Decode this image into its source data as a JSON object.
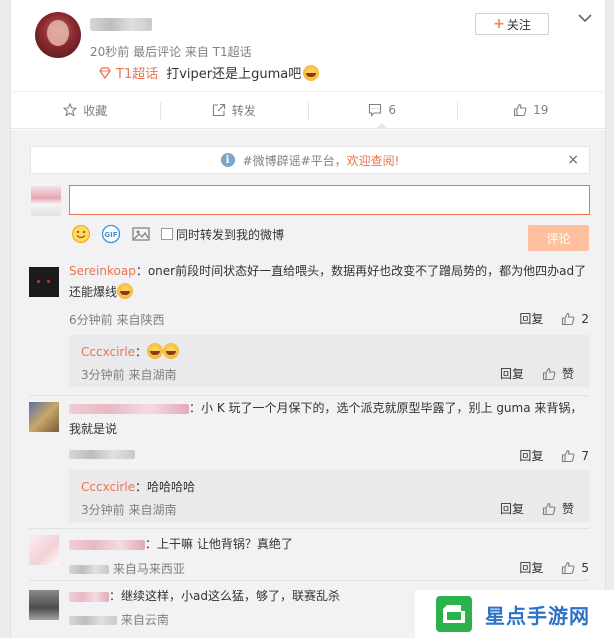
{
  "post": {
    "meta": "20秒前 最后评论 来自 T1超话",
    "topic": "T1超话",
    "body": "打viper还是上guma吧",
    "follow_label": "关注"
  },
  "actions": [
    {
      "label": "收藏",
      "icon": "star-icon"
    },
    {
      "label": "转发",
      "icon": "share-icon"
    },
    {
      "label": "6",
      "icon": "comment-icon"
    },
    {
      "label": "19",
      "icon": "thumbs-up-icon"
    }
  ],
  "notice": {
    "prefix": "#微博辟谣#平台，",
    "link": "欢迎查阅!",
    "close": "×"
  },
  "composer": {
    "input_value": "",
    "repost_label": "同时转发到我的微博",
    "submit_label": "评论"
  },
  "comments": [
    {
      "user": "Sereinkoap",
      "text": "：oner前段时间状态好一直给喂头，数据再好也改变不了蹭局势的，都为他四办ad了还能爆线",
      "meta": "6分钟前 来自陕西",
      "reply_label": "回复",
      "likes": "2",
      "replies": [
        {
          "user": "Cccxcirle",
          "text": "：",
          "meta": "3分钟前 来自湖南",
          "reply_label": "回复",
          "likes": "赞"
        }
      ]
    },
    {
      "user": "",
      "text": "：小 K 玩了一个月保下的，选个派克就原型毕露了，别上 guma 来背锅，我就是说",
      "meta": "",
      "reply_label": "回复",
      "likes": "7",
      "replies": [
        {
          "user": "Cccxcirle",
          "text": "：哈哈哈哈",
          "meta": "3分钟前 来自湖南",
          "reply_label": "回复",
          "likes": "赞"
        }
      ]
    },
    {
      "user": "",
      "text": "：上干嘛 让他背锅？真绝了",
      "meta": "来自马来西亚",
      "reply_label": "回复",
      "likes": "5",
      "replies": []
    },
    {
      "user": "",
      "text": "：继续这样，小ad这么猛，够了，联赛乱杀",
      "meta": "来自云南",
      "reply_label": "",
      "likes": "",
      "replies": []
    }
  ],
  "watermark": {
    "text": "星点手游网"
  },
  "colors": {
    "accent": "#eb7350",
    "submit_disabled": "#ffc09f",
    "watermark_blue": "#2d72c4",
    "watermark_green": "#2bb24c"
  }
}
